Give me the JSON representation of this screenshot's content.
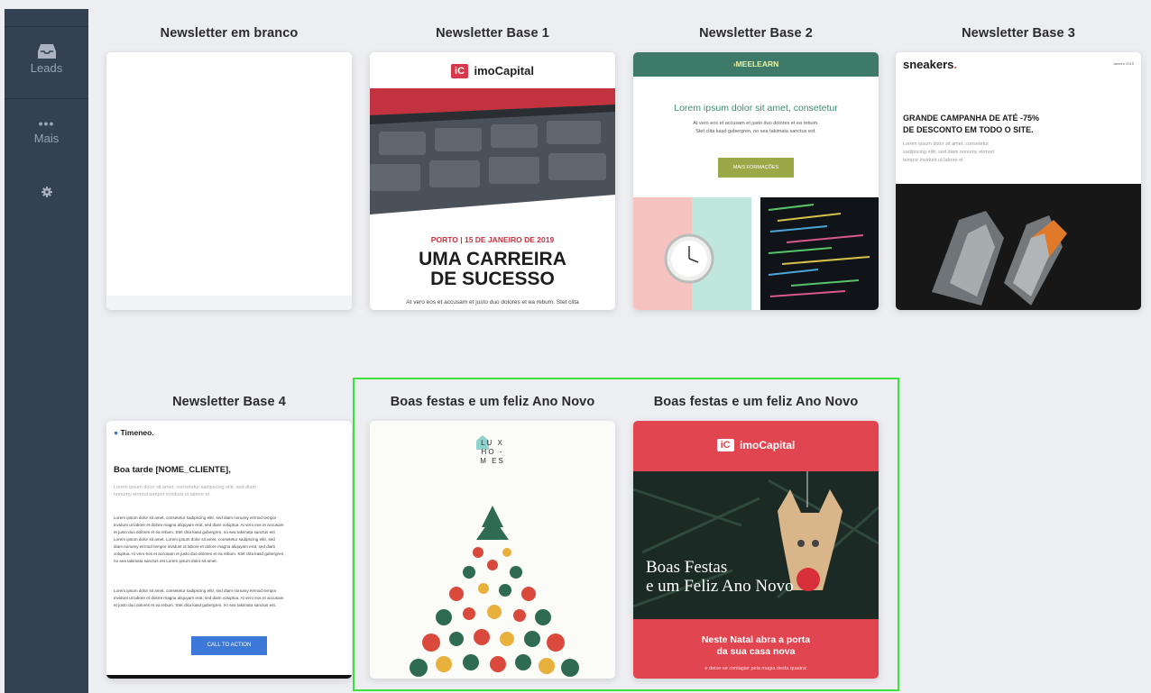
{
  "sidebar": {
    "items": [
      {
        "label": "Leads",
        "icon": "inbox-icon"
      },
      {
        "label": "Mais",
        "icon": "more-dots-icon"
      },
      {
        "label": "",
        "icon": "gear-icon"
      }
    ]
  },
  "templates": [
    {
      "title": "Newsletter em branco"
    },
    {
      "title": "Newsletter Base 1",
      "logo": "imoCapital",
      "logo_badge": "iC",
      "date_line": "PORTO | 15 DE JANEIRO DE 2019",
      "headline1": "UMA CARREIRA",
      "headline2": "DE SUCESSO",
      "body": "At vero eos et accusam et justo duo dolores et ea rebum. Stet clita"
    },
    {
      "title": "Newsletter Base 2",
      "brand": "MEELEARN",
      "heading": "Lorem ipsum dolor sit amet, consetetur",
      "body1": "At vero eos et accusam et justo duo dolores et ea rebum.",
      "body2": "Stet clita kasd gubergren, no sea takimata sanctus est.",
      "button": "MAIS FORMAÇÕES"
    },
    {
      "title": "Newsletter Base 3",
      "brand": "sneakers",
      "brand_dot": ".",
      "date": "Janeiro 2019",
      "headline1": "GRANDE CAMPANHA DE ATÉ -75%",
      "headline2": "DE DESCONTO EM TODO O SITE.",
      "body": [
        "Lorem ipsum dolor sit amet, consetetur",
        "sadipscing elitr, sed diam nonumy eirmod",
        "tempor invidunt ut labore et."
      ]
    },
    {
      "title": "Newsletter Base 4",
      "brand": "Timeneo.",
      "greeting": "Boa tarde [NOME_CLIENTE],",
      "intro": [
        "Lorem ipsum dolor sit amet, consetetur sadipscing elitr, sed diam",
        "nonumy eirmod tempor invidunt ut labore et."
      ],
      "para1": [
        "Lorem ipsum dolor sit amet, consetetur sadipscing elitr, sed diam nonumy eirmod tempor",
        "invidunt ut labore et dolore magna aliquyam erat, sed diam voluptua. At vero eos et accusam",
        "et justo duo dolores et ea rebum. Stet clita kasd gubergren, no sea takimata sanctus est",
        "Lorem ipsum dolor sit amet. Lorem ipsum dolor sit amet, consetetur sadipscing elitr, sed",
        "diam nonumy eirmod tempor invidunt ut labore et dolore magna aliquyam erat, sed diam",
        "voluptua. At vero eos et accusam et justo duo dolores et ea rebum. Stet clita kasd gubergren,",
        "no sea takimata sanctus est Lorem ipsum dolor sit amet."
      ],
      "para2": [
        "Lorem ipsum dolor sit amet, consetetur sadipscing elitr, sed diam nonumy eirmod tempor",
        "invidunt ut labore et dolore magna aliquyam erat, sed diam voluptua. At vero eos et accusam",
        "et justo duo dolores et ea rebum. Stet clita kasd gubergren, no sea takimata sanctus est."
      ],
      "button": "CALL TO ACTION"
    },
    {
      "title": "Boas festas e um feliz Ano Novo",
      "logo_lines": [
        "LU X",
        "HO -",
        "M ES"
      ]
    },
    {
      "title": "Boas festas e um feliz Ano Novo",
      "logo": "imoCapital",
      "logo_badge": "iC",
      "photo_text1": "Boas Festas",
      "photo_text2": "e um Feliz Ano Novo",
      "tagline1": "Neste Natal abra a porta",
      "tagline2": "da sua casa nova",
      "small": "e deixe-se contagiar pela magia desta quadra!"
    }
  ],
  "colors": {
    "sidebar": "#334152",
    "selection": "#3be33b",
    "imo_red": "#d6394a",
    "meelearn_green": "#3d7a6a",
    "cta_blue": "#3c78d8"
  }
}
